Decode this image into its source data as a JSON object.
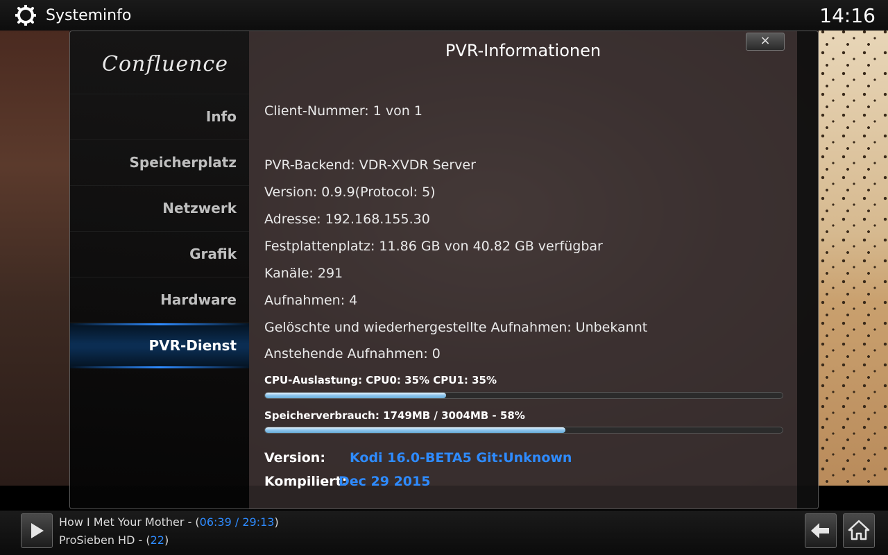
{
  "topbar": {
    "title": "Systeminfo",
    "clock": "14:16"
  },
  "dialog": {
    "title": "PVR-Informationen",
    "close_label": "×",
    "logo": "Confluence"
  },
  "sidebar": {
    "items": [
      {
        "label": "Info",
        "active": false
      },
      {
        "label": "Speicherplatz",
        "active": false
      },
      {
        "label": "Netzwerk",
        "active": false
      },
      {
        "label": "Grafik",
        "active": false
      },
      {
        "label": "Hardware",
        "active": false
      },
      {
        "label": "PVR-Dienst",
        "active": true
      }
    ]
  },
  "info": {
    "client_number": "Client-Nummer: 1 von 1",
    "backend": "PVR-Backend: VDR-XVDR Server",
    "version": "Version: 0.9.9(Protocol: 5)",
    "address": "Adresse: 192.168.155.30",
    "disk": "Festplattenplatz: 11.86 GB von 40.82 GB verfügbar",
    "channels": "Kanäle: 291",
    "recordings": "Aufnahmen: 4",
    "deleted_recordings": "Gelöschte und wiederhergestellte Aufnahmen: Unbekannt",
    "pending_recordings": "Anstehende Aufnahmen: 0"
  },
  "cpu": {
    "label": "CPU-Auslastung: CPU0:  35% CPU1:  35%",
    "percent": 35
  },
  "memory": {
    "label": "Speicherverbrauch: 1749MB / 3004MB - 58%",
    "percent": 58
  },
  "build": {
    "version_label": "Version:",
    "version_value": "Kodi 16.0-BETA5 Git:Unknown",
    "compiled_label": "Kompiliert:",
    "compiled_value": "Dec 29 2015"
  },
  "now_playing": {
    "title_prefix": "How I Met Your Mother - (",
    "time": "06:39 / 29:13",
    "title_suffix": ")",
    "channel_prefix": "ProSieben HD - (",
    "channel_number": "22",
    "channel_suffix": ")"
  },
  "colors": {
    "accent": "#2e8bff",
    "highlight": "#0b2d52"
  }
}
